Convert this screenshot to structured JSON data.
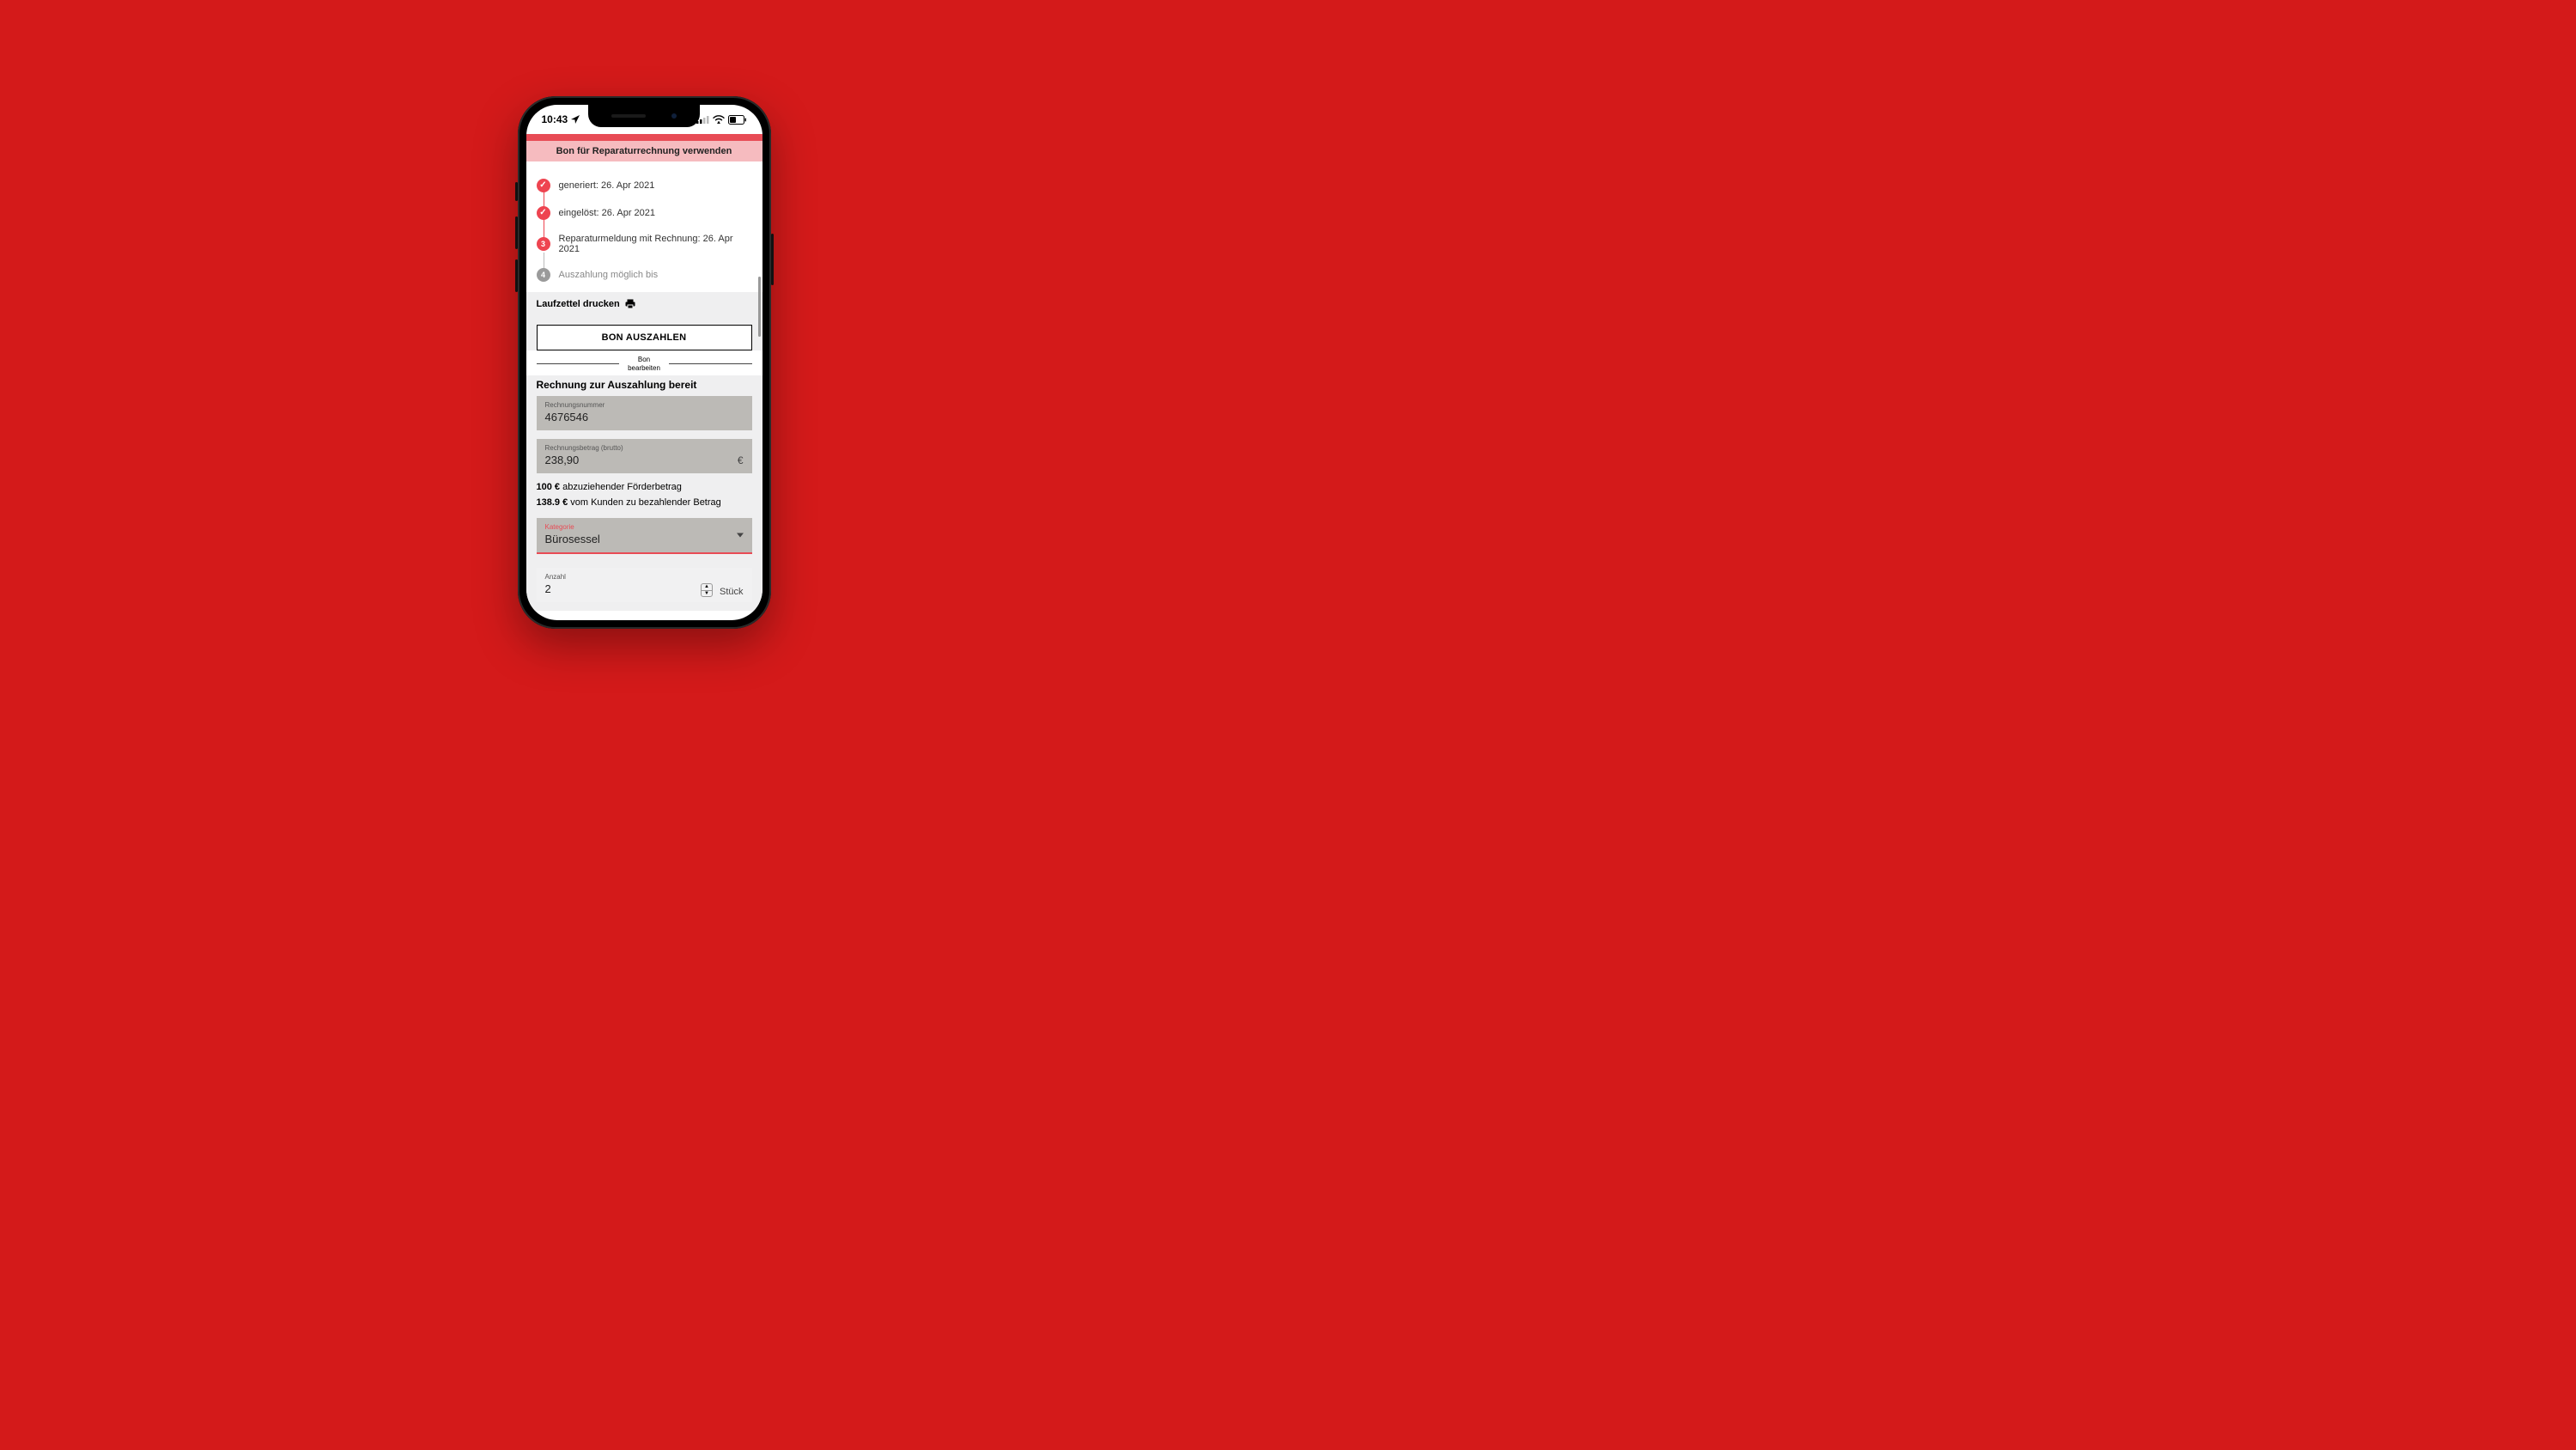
{
  "status": {
    "time": "10:43",
    "locationIcon": "location-arrow"
  },
  "banner": "Bon für Reparaturrechnung verwenden",
  "timeline": [
    {
      "icon": "check",
      "state": "done",
      "text": "generiert: 26. Apr 2021"
    },
    {
      "icon": "check",
      "state": "done",
      "text": "eingelöst: 26. Apr 2021"
    },
    {
      "icon": "3",
      "state": "active",
      "text": "Reparaturmeldung mit Rechnung: 26. Apr 2021"
    },
    {
      "icon": "4",
      "state": "pending",
      "text": "Auszahlung möglich bis"
    }
  ],
  "printLabel": "Laufzettel drucken",
  "payoutButton": "BON AUSZAHLEN",
  "divider": {
    "line1": "Bon",
    "line2": "bearbeiten"
  },
  "sectionTitle": "Rechnung zur Auszahlung bereit",
  "fields": {
    "invoiceNumber": {
      "label": "Rechnungsnummer",
      "value": "4676546"
    },
    "invoiceAmount": {
      "label": "Rechnungsbetrag (brutto)",
      "value": "238,90",
      "currency": "€"
    }
  },
  "deduction": {
    "amount": "100 €",
    "text": " abzuziehender Förderbetrag"
  },
  "customerPays": {
    "amount": "138.9 €",
    "text": " vom Kunden zu bezahlender Betrag"
  },
  "category": {
    "label": "Kategorie",
    "value": "Bürosessel"
  },
  "quantity": {
    "label": "Anzahl",
    "value": "2",
    "unit": "Stück"
  }
}
